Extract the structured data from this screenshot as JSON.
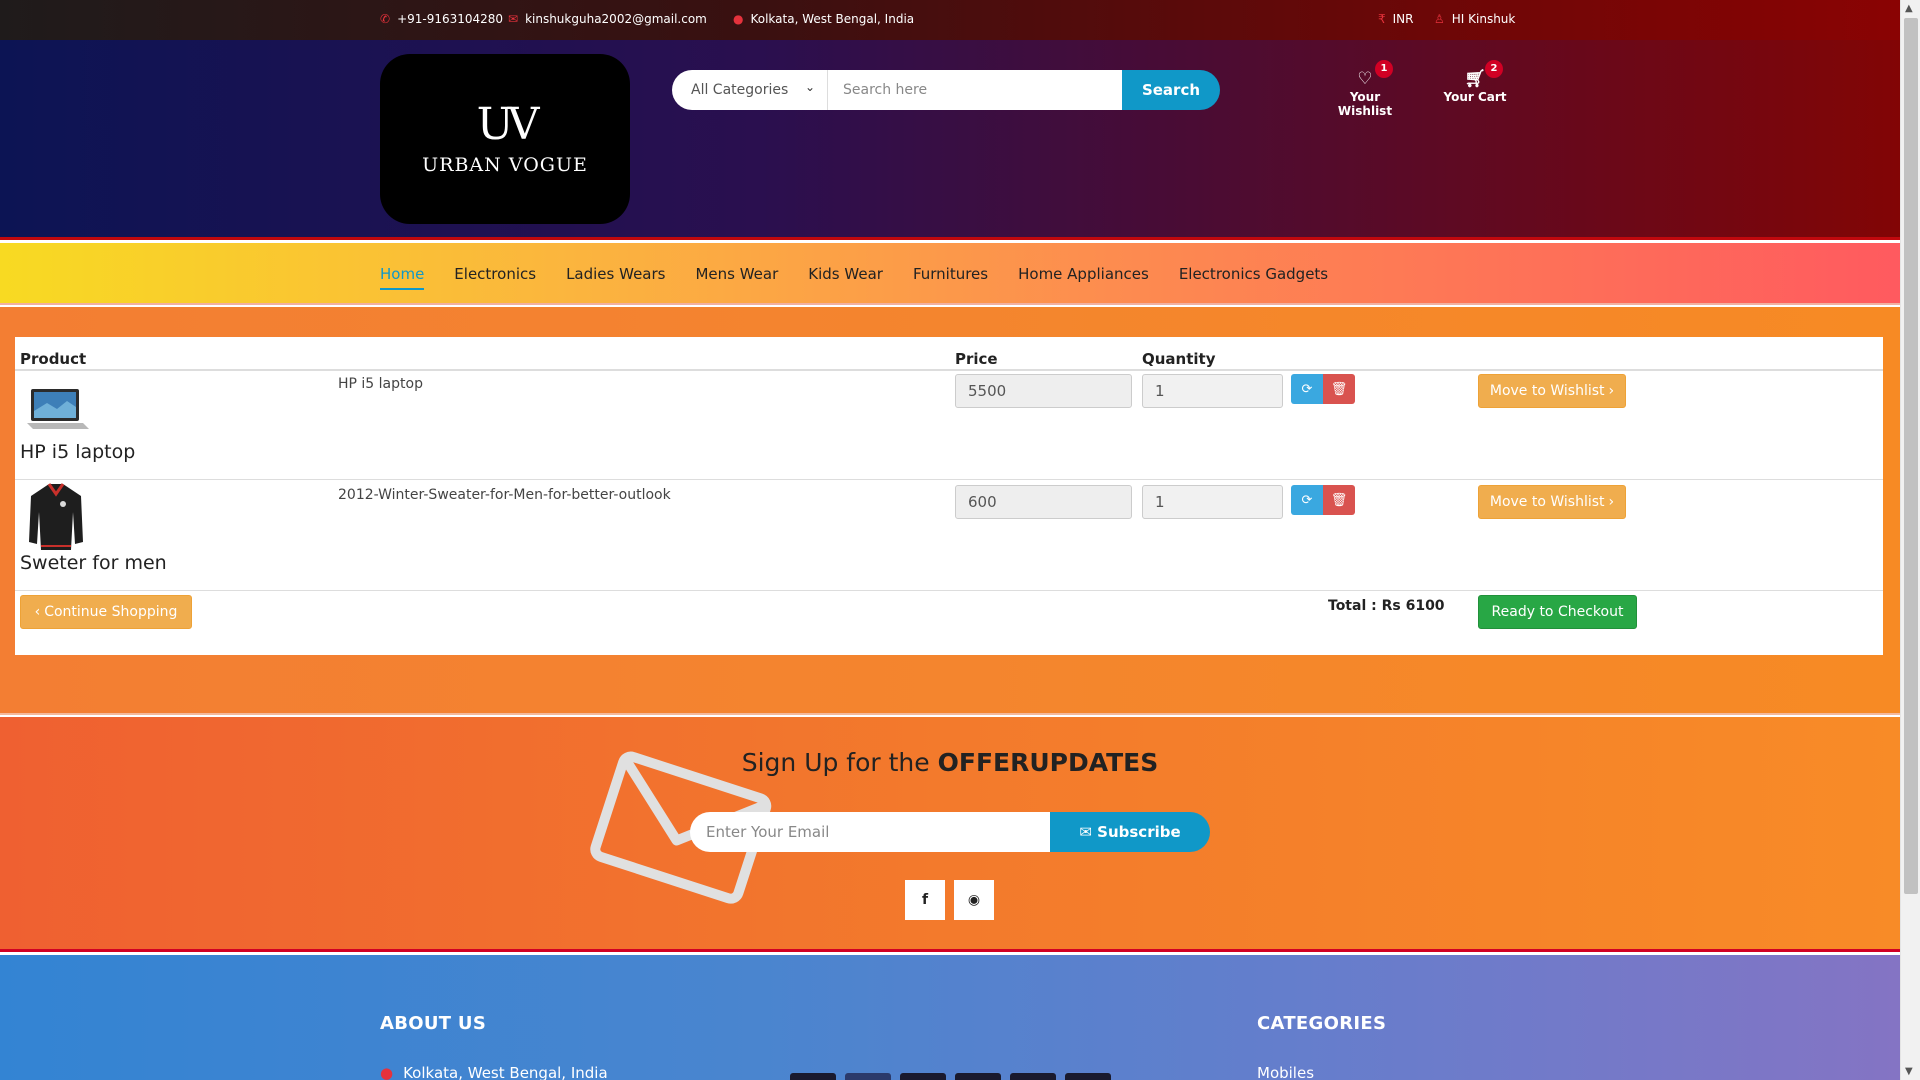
{
  "topbar": {
    "phone": "+91-9163104280",
    "email": "kinshukguha2002@gmail.com",
    "location": "Kolkata, West Bengal, India",
    "currency": "INR",
    "user_greeting": "HI Kinshuk"
  },
  "logo": {
    "monogram": "UV",
    "name": "URBAN VOGUE"
  },
  "search": {
    "category_selected": "All Categories",
    "placeholder": "Search here",
    "button_label": "Search"
  },
  "header_links": {
    "wishlist": {
      "label": "Your Wishlist",
      "count": "1"
    },
    "cart": {
      "label": "Your Cart",
      "count": "2"
    }
  },
  "nav": {
    "items": [
      "Home",
      "Electronics",
      "Ladies Wears",
      "Mens Wear",
      "Kids Wear",
      "Furnitures",
      "Home Appliances",
      "Electronics Gadgets"
    ],
    "active": "Home"
  },
  "cart": {
    "headers": {
      "product": "Product",
      "price": "Price",
      "quantity": "Quantity"
    },
    "items": [
      {
        "thumb_caption": "HP i5 laptop",
        "name": "HP i5 laptop",
        "price": "5500",
        "qty": "1",
        "wishlist_label": "Move to Wishlist"
      },
      {
        "thumb_caption": "Sweter for men",
        "name": "2012-Winter-Sweater-for-Men-for-better-outlook",
        "price": "600",
        "qty": "1",
        "wishlist_label": "Move to Wishlist"
      }
    ],
    "continue_label": "Continue Shopping",
    "total_label": "Total : Rs 6100",
    "checkout_label": "Ready to Checkout"
  },
  "newsletter": {
    "title_prefix": "Sign Up for the ",
    "title_bold": "OFFERUPDATES",
    "placeholder": "Enter Your Email",
    "button_label": "Subscribe"
  },
  "social": {
    "facebook_glyph": "f",
    "github_glyph": "◉"
  },
  "footer": {
    "about_title": "ABOUT US",
    "address": "Kolkata, West Bengal, India",
    "categories_title": "CATEGORIES",
    "first_category": "Mobiles"
  },
  "colors": {
    "accent_blue": "#1098c8",
    "badge_red": "#d10024",
    "warning": "#f0ad4e",
    "success": "#28a745"
  }
}
